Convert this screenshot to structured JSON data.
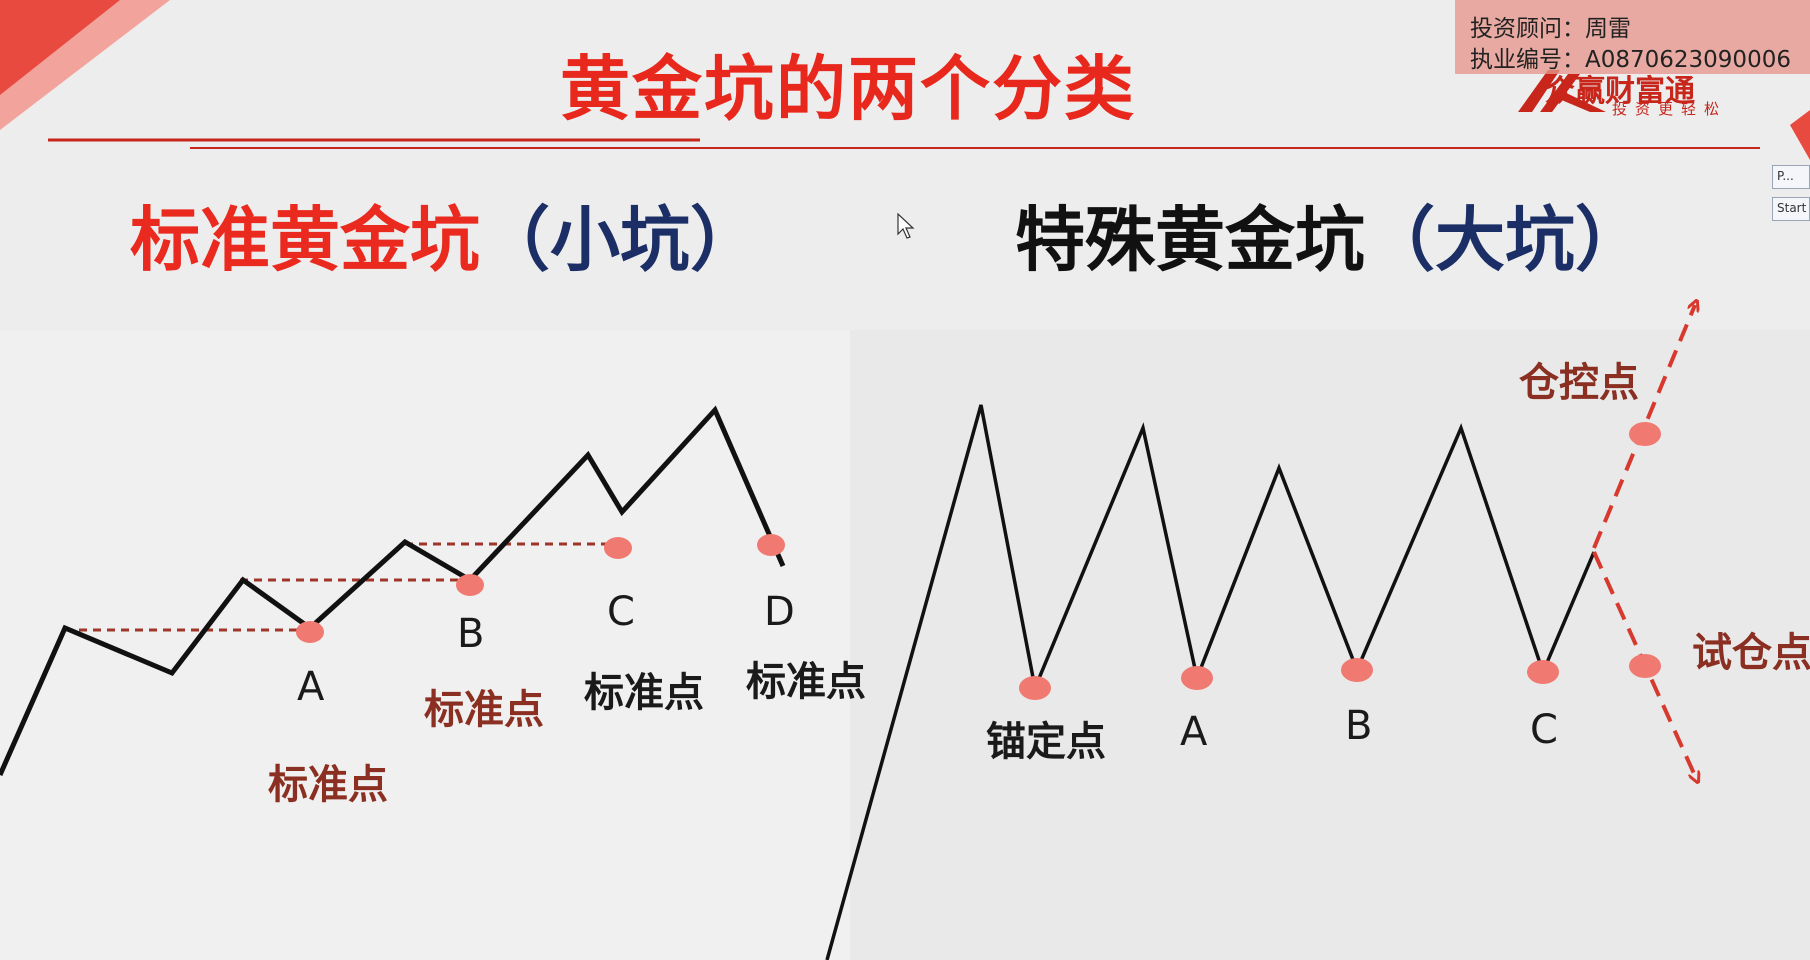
{
  "title": "黄金坑的两个分类",
  "badge": {
    "advisor_label": "投资顾问：周雷",
    "license_label": "执业编号：A0870623090006"
  },
  "logo": {
    "name": "众赢财富通",
    "slogan": "投资更轻松"
  },
  "left_panel": {
    "heading_main": "标准黄金坑",
    "heading_paren": "（小坑）",
    "points": [
      {
        "letter": "A",
        "label": "标准点"
      },
      {
        "letter": "B",
        "label": "标准点"
      },
      {
        "letter": "C",
        "label": "标准点"
      },
      {
        "letter": "D",
        "label": "标准点"
      }
    ]
  },
  "right_panel": {
    "heading_main": "特殊黄金坑",
    "heading_paren": "（大坑）",
    "anchor_label": "锚定点",
    "points": [
      "A",
      "B",
      "C"
    ],
    "up_label": "仓控点",
    "down_label": "试仓点"
  },
  "window_widget": {
    "field_text": "P...",
    "button_text": "Start"
  },
  "colors": {
    "title_red": "#e8281c",
    "paren_navy": "#1b2f66",
    "label_brown": "#8a2f22",
    "dot_red": "#f07a72",
    "arrow_red": "#d8392e",
    "line_black": "#111111"
  }
}
